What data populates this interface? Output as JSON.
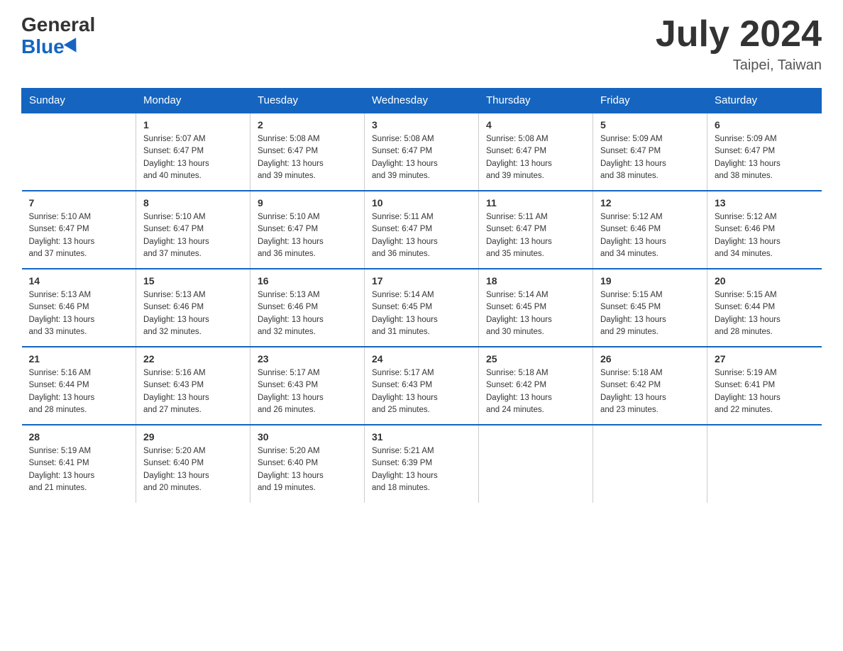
{
  "header": {
    "logo_general": "General",
    "logo_blue": "Blue",
    "month_year": "July 2024",
    "location": "Taipei, Taiwan"
  },
  "weekdays": [
    "Sunday",
    "Monday",
    "Tuesday",
    "Wednesday",
    "Thursday",
    "Friday",
    "Saturday"
  ],
  "weeks": [
    [
      {
        "day": "",
        "info": ""
      },
      {
        "day": "1",
        "info": "Sunrise: 5:07 AM\nSunset: 6:47 PM\nDaylight: 13 hours\nand 40 minutes."
      },
      {
        "day": "2",
        "info": "Sunrise: 5:08 AM\nSunset: 6:47 PM\nDaylight: 13 hours\nand 39 minutes."
      },
      {
        "day": "3",
        "info": "Sunrise: 5:08 AM\nSunset: 6:47 PM\nDaylight: 13 hours\nand 39 minutes."
      },
      {
        "day": "4",
        "info": "Sunrise: 5:08 AM\nSunset: 6:47 PM\nDaylight: 13 hours\nand 39 minutes."
      },
      {
        "day": "5",
        "info": "Sunrise: 5:09 AM\nSunset: 6:47 PM\nDaylight: 13 hours\nand 38 minutes."
      },
      {
        "day": "6",
        "info": "Sunrise: 5:09 AM\nSunset: 6:47 PM\nDaylight: 13 hours\nand 38 minutes."
      }
    ],
    [
      {
        "day": "7",
        "info": "Sunrise: 5:10 AM\nSunset: 6:47 PM\nDaylight: 13 hours\nand 37 minutes."
      },
      {
        "day": "8",
        "info": "Sunrise: 5:10 AM\nSunset: 6:47 PM\nDaylight: 13 hours\nand 37 minutes."
      },
      {
        "day": "9",
        "info": "Sunrise: 5:10 AM\nSunset: 6:47 PM\nDaylight: 13 hours\nand 36 minutes."
      },
      {
        "day": "10",
        "info": "Sunrise: 5:11 AM\nSunset: 6:47 PM\nDaylight: 13 hours\nand 36 minutes."
      },
      {
        "day": "11",
        "info": "Sunrise: 5:11 AM\nSunset: 6:47 PM\nDaylight: 13 hours\nand 35 minutes."
      },
      {
        "day": "12",
        "info": "Sunrise: 5:12 AM\nSunset: 6:46 PM\nDaylight: 13 hours\nand 34 minutes."
      },
      {
        "day": "13",
        "info": "Sunrise: 5:12 AM\nSunset: 6:46 PM\nDaylight: 13 hours\nand 34 minutes."
      }
    ],
    [
      {
        "day": "14",
        "info": "Sunrise: 5:13 AM\nSunset: 6:46 PM\nDaylight: 13 hours\nand 33 minutes."
      },
      {
        "day": "15",
        "info": "Sunrise: 5:13 AM\nSunset: 6:46 PM\nDaylight: 13 hours\nand 32 minutes."
      },
      {
        "day": "16",
        "info": "Sunrise: 5:13 AM\nSunset: 6:46 PM\nDaylight: 13 hours\nand 32 minutes."
      },
      {
        "day": "17",
        "info": "Sunrise: 5:14 AM\nSunset: 6:45 PM\nDaylight: 13 hours\nand 31 minutes."
      },
      {
        "day": "18",
        "info": "Sunrise: 5:14 AM\nSunset: 6:45 PM\nDaylight: 13 hours\nand 30 minutes."
      },
      {
        "day": "19",
        "info": "Sunrise: 5:15 AM\nSunset: 6:45 PM\nDaylight: 13 hours\nand 29 minutes."
      },
      {
        "day": "20",
        "info": "Sunrise: 5:15 AM\nSunset: 6:44 PM\nDaylight: 13 hours\nand 28 minutes."
      }
    ],
    [
      {
        "day": "21",
        "info": "Sunrise: 5:16 AM\nSunset: 6:44 PM\nDaylight: 13 hours\nand 28 minutes."
      },
      {
        "day": "22",
        "info": "Sunrise: 5:16 AM\nSunset: 6:43 PM\nDaylight: 13 hours\nand 27 minutes."
      },
      {
        "day": "23",
        "info": "Sunrise: 5:17 AM\nSunset: 6:43 PM\nDaylight: 13 hours\nand 26 minutes."
      },
      {
        "day": "24",
        "info": "Sunrise: 5:17 AM\nSunset: 6:43 PM\nDaylight: 13 hours\nand 25 minutes."
      },
      {
        "day": "25",
        "info": "Sunrise: 5:18 AM\nSunset: 6:42 PM\nDaylight: 13 hours\nand 24 minutes."
      },
      {
        "day": "26",
        "info": "Sunrise: 5:18 AM\nSunset: 6:42 PM\nDaylight: 13 hours\nand 23 minutes."
      },
      {
        "day": "27",
        "info": "Sunrise: 5:19 AM\nSunset: 6:41 PM\nDaylight: 13 hours\nand 22 minutes."
      }
    ],
    [
      {
        "day": "28",
        "info": "Sunrise: 5:19 AM\nSunset: 6:41 PM\nDaylight: 13 hours\nand 21 minutes."
      },
      {
        "day": "29",
        "info": "Sunrise: 5:20 AM\nSunset: 6:40 PM\nDaylight: 13 hours\nand 20 minutes."
      },
      {
        "day": "30",
        "info": "Sunrise: 5:20 AM\nSunset: 6:40 PM\nDaylight: 13 hours\nand 19 minutes."
      },
      {
        "day": "31",
        "info": "Sunrise: 5:21 AM\nSunset: 6:39 PM\nDaylight: 13 hours\nand 18 minutes."
      },
      {
        "day": "",
        "info": ""
      },
      {
        "day": "",
        "info": ""
      },
      {
        "day": "",
        "info": ""
      }
    ]
  ]
}
